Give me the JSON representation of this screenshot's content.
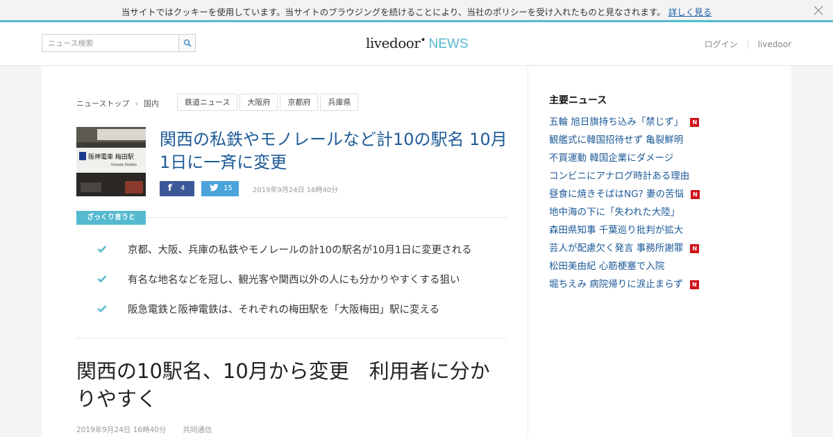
{
  "cookie_bar": {
    "text": "当サイトではクッキーを使用しています。当サイトのブラウジングを続けることにより、当社のポリシーを受け入れたものと見なされます。",
    "link": "詳しく見る"
  },
  "header": {
    "search_placeholder": "ニュース検索",
    "logo_main": "livedoor",
    "logo_news": "NEWS",
    "login": "ログイン",
    "livedoor_link": "livedoor"
  },
  "breadcrumb": {
    "top": "ニューストップ",
    "arrow": "›",
    "category": "国内"
  },
  "tags": [
    "鉄道ニュース",
    "大阪府",
    "京都府",
    "兵庫県"
  ],
  "headline": "関西の私鉄やモノレールなど計10の駅名 10月1日に一斉に変更",
  "share": {
    "facebook_count": "4",
    "twitter_count": "15",
    "date": "2019年9月24日 16時40分"
  },
  "summary": {
    "label": "ざっくり言うと",
    "items": [
      "京都、大阪、兵庫の私鉄やモノレールの計10の駅名が10月1日に変更される",
      "有名な地名などを冠し、観光客や関西以外の人にも分かりやすくする狙い",
      "阪急電鉄と阪神電鉄は、それぞれの梅田駅を「大阪梅田」駅に変える"
    ]
  },
  "article": {
    "title": "関西の10駅名、10月から変更　利用者に分かりやすく",
    "date": "2019年9月24日 16時40分",
    "source": "共同通信"
  },
  "thumbnail": {
    "sign_text": "阪神電車 梅田駅",
    "sign_sub": "Umeda Station"
  },
  "side": {
    "title": "主要ニュース",
    "new_badge": "N",
    "items": [
      {
        "text": "五輪 旭日旗持ち込み「禁じず」",
        "new": true
      },
      {
        "text": "観艦式に韓国招待せず 亀裂鮮明",
        "new": false
      },
      {
        "text": "不買運動 韓国企業にダメージ",
        "new": false
      },
      {
        "text": "コンビニにアナログ時計ある理由",
        "new": false
      },
      {
        "text": "昼食に焼きそばはNG? 妻の苦悩",
        "new": true
      },
      {
        "text": "地中海の下に「失われた大陸」",
        "new": false
      },
      {
        "text": "森田県知事 千葉巡り批判が拡大",
        "new": false
      },
      {
        "text": "芸人が配慮欠く発言 事務所謝罪",
        "new": true
      },
      {
        "text": "松田美由紀 心筋梗塞で入院",
        "new": false
      },
      {
        "text": "堀ちえみ 病院帰りに涙止まらず",
        "new": true
      }
    ]
  },
  "colors": {
    "accent": "#55b9cf",
    "link": "#1d5a97",
    "facebook": "#3b5998",
    "twitter": "#4ba3dc",
    "badge": "#d0121b"
  }
}
